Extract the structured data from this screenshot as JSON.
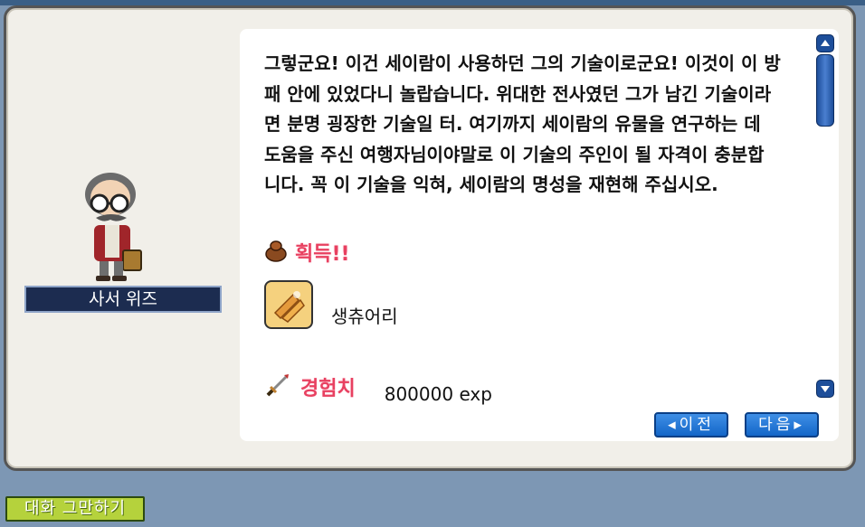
{
  "npc": {
    "name": "사서 위즈"
  },
  "dialog": {
    "lines": [
      "그렇군요! 이건 세이람이 사용하던 그의 기술이로군요! 이것이 이 방",
      "패 안에 있었다니 놀랍습니다. 위대한 전사였던 그가 남긴 기술이라",
      "면 분명 굉장한 기술일 터. 여기까지 세이람의 유물을 연구하는 데",
      "도움을 주신 여행자님이야말로 이 기술의 주인이 될 자격이 충분합",
      "니다. 꼭 이 기술을 익혀, 세이람의 명성을 재현해 주십시오."
    ]
  },
  "rewards": {
    "acquire_label": "획득!!",
    "item_name": "생츄어리",
    "exp_label": "경험치",
    "exp_value": "800000 exp"
  },
  "buttons": {
    "prev_label": "◂이전",
    "next_label": "다음▸",
    "end_chat_label": "대화 그만하기"
  },
  "colors": {
    "accent_red": "#e84060",
    "nav_blue": "#1366c8",
    "end_chat_green": "#b5d23c",
    "name_bg": "#1c2c50"
  }
}
